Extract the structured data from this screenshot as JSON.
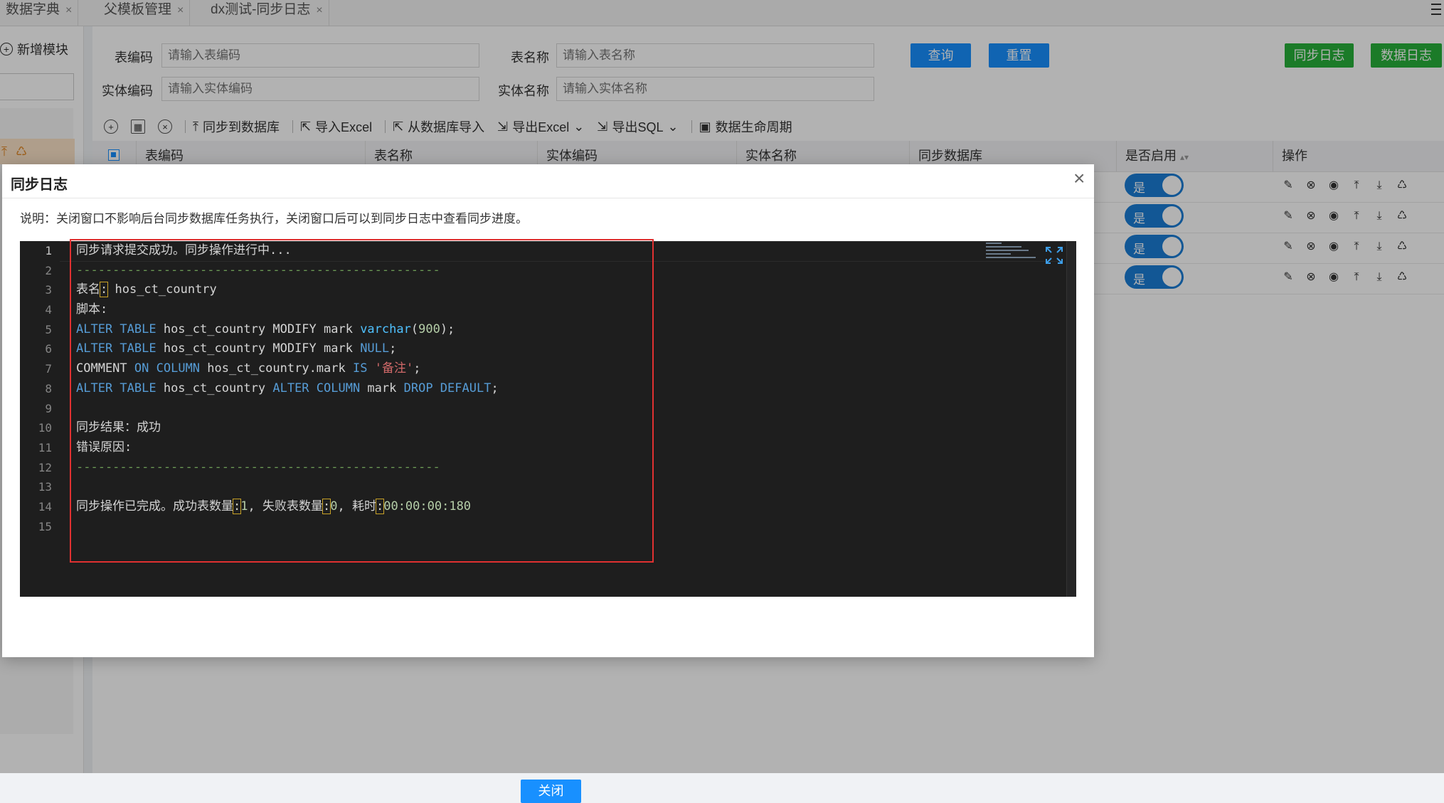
{
  "tabs": [
    {
      "label": "数据字典"
    },
    {
      "label": "父模板管理"
    },
    {
      "label": "dx测试-同步日志"
    }
  ],
  "tab_close_glyph": "×",
  "sidebar": {
    "add_module_label": "新增模块"
  },
  "filters": {
    "table_code_label": "表编码",
    "table_code_placeholder": "请输入表编码",
    "table_name_label": "表名称",
    "table_name_placeholder": "请输入表名称",
    "entity_code_label": "实体编码",
    "entity_code_placeholder": "请输入实体编码",
    "entity_name_label": "实体名称",
    "entity_name_placeholder": "请输入实体名称",
    "query_label": "查询",
    "reset_label": "重置",
    "sync_log_label": "同步日志",
    "data_log_label": "数据日志"
  },
  "toolbar": {
    "sync_db_label": "同步到数据库",
    "import_excel_label": "导入Excel",
    "import_from_db_label": "从数据库导入",
    "export_excel_label": "导出Excel",
    "export_sql_label": "导出SQL",
    "lifecycle_label": "数据生命周期"
  },
  "table": {
    "headers": [
      "表编码",
      "表名称",
      "实体编码",
      "实体名称",
      "同步数据库",
      "是否启用",
      "操作"
    ],
    "rows": [
      {
        "enabled_label": "是"
      },
      {
        "enabled_label": "是"
      },
      {
        "enabled_label": "是"
      },
      {
        "enabled_label": "是"
      }
    ]
  },
  "modal": {
    "title": "同步日志",
    "note": "说明：关闭窗口不影响后台同步数据库任务执行，关闭窗口后可以到同步日志中查看同步进度。",
    "close_button_label": "关闭",
    "close_icon": "×",
    "line_numbers": [
      "1",
      "2",
      "3",
      "4",
      "5",
      "6",
      "7",
      "8",
      "9",
      "10",
      "11",
      "12",
      "13",
      "14",
      "15"
    ],
    "log": {
      "line1": "同步请求提交成功。同步操作进行中...",
      "separator": "--------------------------------------------------",
      "table_label": "表名",
      "colon": ":",
      "table_name": " hos_ct_country",
      "script_label": "脚本:",
      "alter_table": "ALTER TABLE",
      "table_ref": " hos_ct_country ",
      "modify_mark": "MODIFY mark ",
      "varchar": "varchar",
      "open_paren": "(",
      "len": "900",
      "close_paren_semi": ");",
      "null_kw": "NULL",
      "semi": ";",
      "comment_kw": "COMMENT ",
      "on_kw": "ON",
      "space": " ",
      "column_kw": "COLUMN",
      "col_ref": " hos_ct_country.mark ",
      "is_kw": "IS",
      "comment_val": " '备注'",
      "alter_column": "ALTER COLUMN",
      "mark_word": " mark ",
      "drop_default": "DROP DEFAULT",
      "result_line": "同步结果：成功",
      "error_line": "错误原因:",
      "done_prefix": "同步操作已完成。成功表数量",
      "success_count": "1",
      "fail_prefix": ", 失败表数量",
      "fail_count": "0",
      "elapsed_prefix": ", 耗时",
      "elapsed": "00:00:00:180"
    }
  },
  "colors": {
    "primary": "#1890ff",
    "success": "#27b13a",
    "editor_bg": "#1e1e1e",
    "keyword": "#569cd6",
    "string": "#d16969",
    "number": "#b5cea8",
    "highlight_box": "#e03131"
  }
}
